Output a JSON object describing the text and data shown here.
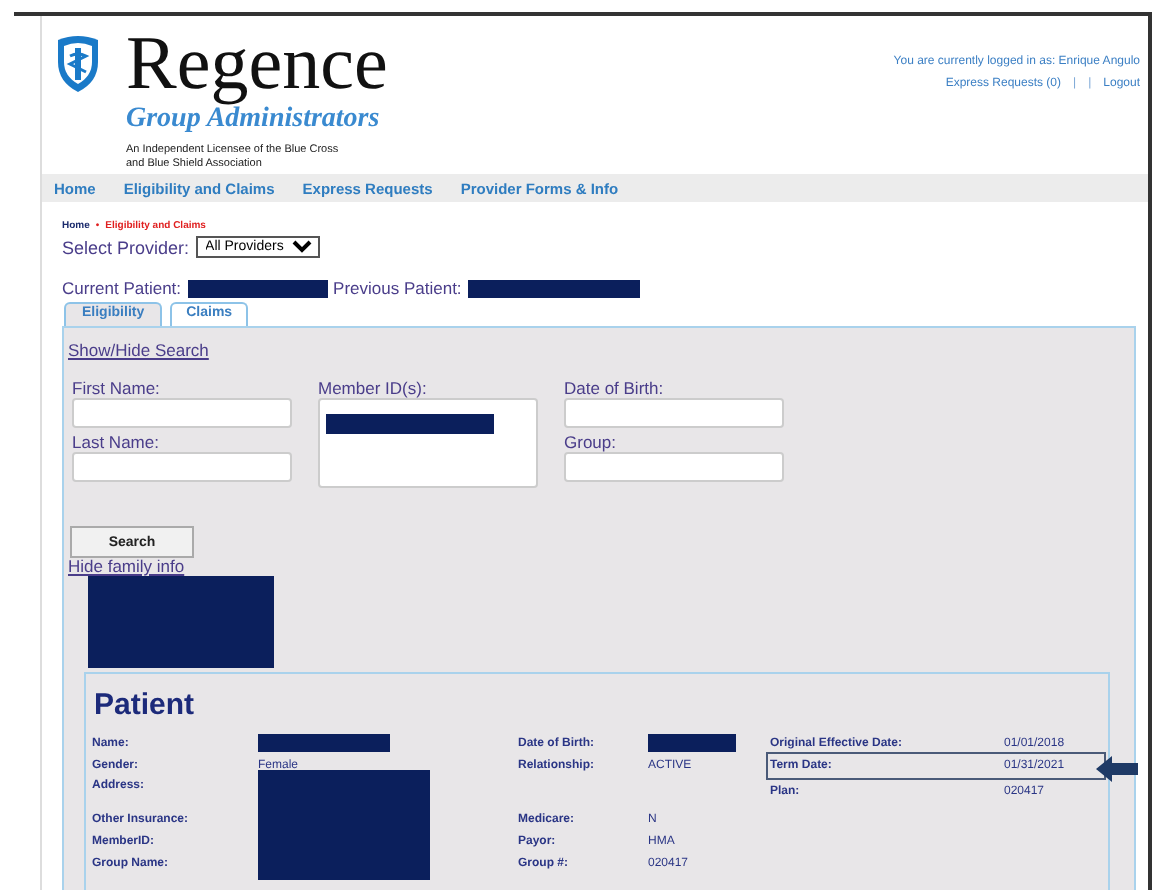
{
  "header": {
    "brand": "Regence",
    "subtitle": "Group Administrators",
    "tagline": [
      "An Independent Licensee of the Blue Cross",
      "and Blue Shield Association"
    ],
    "login_text": "You are currently logged in as: Enrique Angulo",
    "top_links": [
      {
        "text": "Express Requests (0)",
        "kind": "link"
      },
      {
        "text": "|",
        "kind": "separator"
      },
      {
        "text": "|",
        "kind": "separator"
      },
      {
        "text": "Logout",
        "kind": "link"
      }
    ]
  },
  "nav": [
    "Home",
    "Eligibility and Claims",
    "Express Requests",
    "Provider Forms & Info"
  ],
  "breadcrumb": {
    "separator": "•",
    "items": [
      {
        "text": "Home",
        "current": false
      },
      {
        "text": "Eligibility and Claims",
        "current": true
      }
    ]
  },
  "provider_select": {
    "label": "Select Provider:",
    "value": "All Providers"
  },
  "patient_bar": [
    {
      "label": "Current Patient:",
      "redacted": true
    },
    {
      "label": "Previous Patient:",
      "redacted": true
    }
  ],
  "tabs": [
    {
      "label": "Eligibility",
      "selected": true
    },
    {
      "label": "Claims",
      "selected": false
    }
  ],
  "search_panel": {
    "toggle_link": "Show/Hide Search",
    "fields": [
      {
        "label": "First Name:",
        "kind": "input"
      },
      {
        "label": "Member ID(s):",
        "kind": "textarea",
        "redacted": true
      },
      {
        "label": "Date of Birth:",
        "kind": "input"
      },
      {
        "label": "Last Name:",
        "kind": "input"
      },
      {
        "label": "Group:",
        "kind": "input"
      }
    ],
    "button": "Search",
    "family_link": "Hide family info",
    "family_redacted": true
  },
  "patient": {
    "title": "Patient",
    "fields": [
      {
        "label": "Name:",
        "redacted": true
      },
      {
        "label": "Date of Birth:",
        "redacted": true
      },
      {
        "label": "Original Effective Date:",
        "value": "01/01/2018"
      },
      {
        "label": "Gender:",
        "value": "Female"
      },
      {
        "label": "Relationship:",
        "value": "ACTIVE"
      },
      {
        "label": "Term Date:",
        "value": "01/31/2021",
        "highlighted": true
      },
      {
        "label": "Address:",
        "redacted": true
      },
      {
        "label": "Plan:",
        "value": "020417"
      },
      {
        "label": "Other Insurance:"
      },
      {
        "label": "Medicare:",
        "value": "N"
      },
      {
        "label": "MemberID:"
      },
      {
        "label": "Payor:",
        "value": "HMA"
      },
      {
        "label": "Group Name:"
      },
      {
        "label": "Group #:",
        "value": "020417"
      }
    ]
  }
}
